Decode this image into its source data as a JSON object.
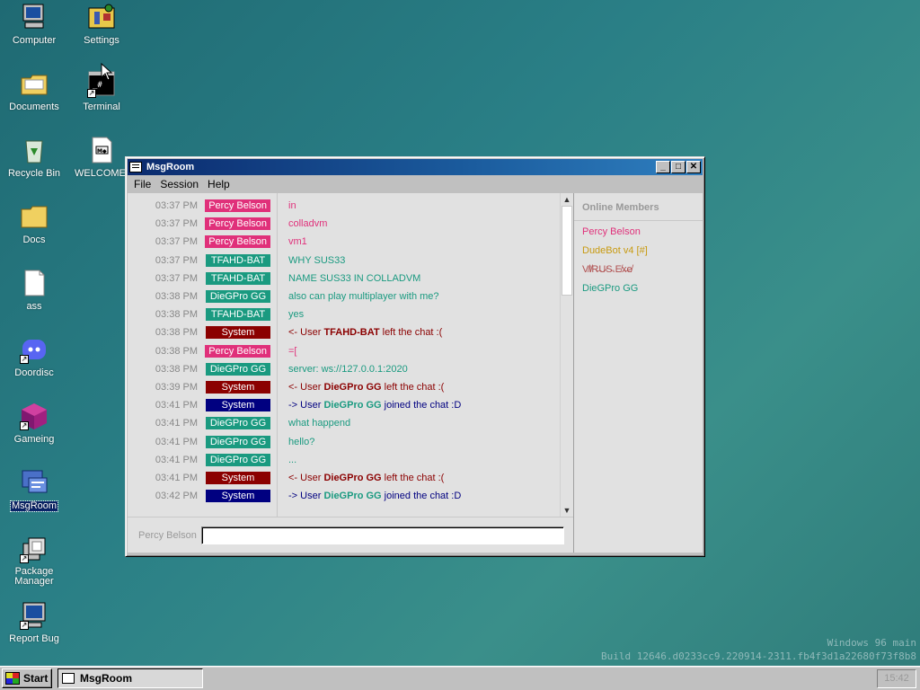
{
  "desktop": {
    "icons": [
      {
        "label": "Computer",
        "icon": "computer-icon"
      },
      {
        "label": "Settings",
        "icon": "settings-icon"
      },
      {
        "label": "Documents",
        "icon": "documents-folder-icon"
      },
      {
        "label": "Terminal",
        "icon": "terminal-icon"
      },
      {
        "label": "Recycle Bin",
        "icon": "recycle-bin-icon"
      },
      {
        "label": "WELCOME.",
        "icon": "markdown-file-icon"
      },
      {
        "label": "Docs",
        "icon": "folder-icon"
      },
      {
        "label": "ass",
        "icon": "file-icon"
      },
      {
        "label": "Doordisc",
        "icon": "discord-icon"
      },
      {
        "label": "Gameing",
        "icon": "game-cube-icon"
      },
      {
        "label": "MsgRoom",
        "icon": "msgroom-icon"
      },
      {
        "label": "Package Manager",
        "icon": "package-manager-icon"
      },
      {
        "label": "Report Bug",
        "icon": "report-bug-icon"
      }
    ],
    "build_line1": "Windows 96 main",
    "build_line2": "Build 12646.d0233cc9.220914-2311.fb4f3d1a22680f73f8b8"
  },
  "window": {
    "title": "MsgRoom",
    "menu": [
      "File",
      "Session",
      "Help"
    ],
    "messages": [
      {
        "time": "03:37 PM",
        "user": "Percy Belson",
        "color": "#e0307a",
        "text": "in"
      },
      {
        "time": "03:37 PM",
        "user": "Percy Belson",
        "color": "#e0307a",
        "text": "colladvm"
      },
      {
        "time": "03:37 PM",
        "user": "Percy Belson",
        "color": "#e0307a",
        "text": "vm1"
      },
      {
        "time": "03:37 PM",
        "user": "TFAHD-BAT",
        "color": "#1a9a80",
        "text": "WHY SUS33"
      },
      {
        "time": "03:37 PM",
        "user": "TFAHD-BAT",
        "color": "#1a9a80",
        "text": "NAME SUS33 IN COLLADVM"
      },
      {
        "time": "03:38 PM",
        "user": "DieGPro GG",
        "color": "#1a9a80",
        "text": "also can play multiplayer with me?"
      },
      {
        "time": "03:38 PM",
        "user": "TFAHD-BAT",
        "color": "#1a9a80",
        "text": "yes"
      },
      {
        "time": "03:38 PM",
        "user": "System",
        "color": "#8b0000",
        "sys_prefix": "<- User ",
        "sys_user": "TFAHD-BAT",
        "sys_user_color": "#8b0000",
        "sys_suffix": " left the chat :("
      },
      {
        "time": "03:38 PM",
        "user": "Percy Belson",
        "color": "#e0307a",
        "text": "=["
      },
      {
        "time": "03:38 PM",
        "user": "DieGPro GG",
        "color": "#1a9a80",
        "text": "server: ws://127.0.0.1:2020"
      },
      {
        "time": "03:39 PM",
        "user": "System",
        "color": "#8b0000",
        "sys_prefix": "<- User ",
        "sys_user": "DieGPro GG",
        "sys_user_color": "#8b0000",
        "sys_suffix": " left the chat :("
      },
      {
        "time": "03:41 PM",
        "user": "System",
        "color": "#000080",
        "sys_prefix": "-> User ",
        "sys_user": "DieGPro GG",
        "sys_user_color": "#1a9a80",
        "sys_suffix": " joined the chat :D"
      },
      {
        "time": "03:41 PM",
        "user": "DieGPro GG",
        "color": "#1a9a80",
        "text": "what happend"
      },
      {
        "time": "03:41 PM",
        "user": "DieGPro GG",
        "color": "#1a9a80",
        "text": "hello?"
      },
      {
        "time": "03:41 PM",
        "user": "DieGPro GG",
        "color": "#1a9a80",
        "text": "..."
      },
      {
        "time": "03:41 PM",
        "user": "System",
        "color": "#8b0000",
        "sys_prefix": "<- User ",
        "sys_user": "DieGPro GG",
        "sys_user_color": "#8b0000",
        "sys_suffix": " left the chat :("
      },
      {
        "time": "03:42 PM",
        "user": "System",
        "color": "#000080",
        "sys_prefix": "-> User ",
        "sys_user": "DieGPro GG",
        "sys_user_color": "#1a9a80",
        "sys_suffix": " joined the chat :D"
      }
    ],
    "input_label": "Percy Belson",
    "members_title": "Online Members",
    "members": [
      {
        "name": "Percy Belson",
        "color": "#e0307a"
      },
      {
        "name": "DudeBot v4 [#]",
        "color": "#c89a10"
      },
      {
        "name": "V̸I̸R̶U̷S̵.E̸x̶e̸",
        "color": "#b05050"
      },
      {
        "name": "DieGPro GG",
        "color": "#1a9a80"
      }
    ]
  },
  "taskbar": {
    "start_label": "Start",
    "task_label": "MsgRoom",
    "clock": "15:42"
  }
}
